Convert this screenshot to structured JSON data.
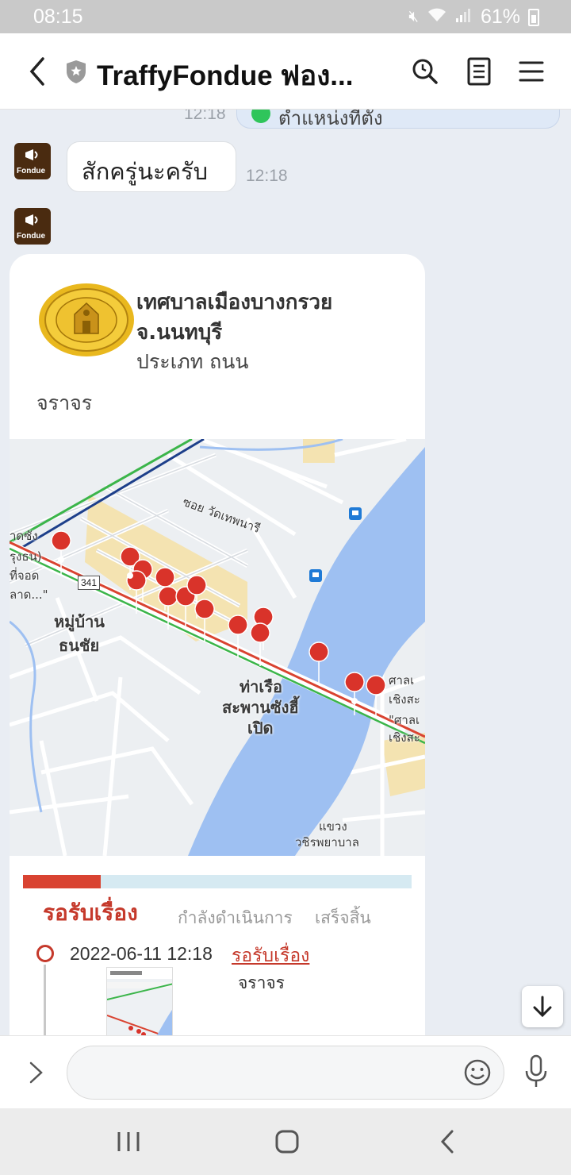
{
  "status_bar": {
    "time": "08:15",
    "battery": "61%"
  },
  "header": {
    "title": "TraffyFondue ฟอง..."
  },
  "chat": {
    "previous_message": {
      "text": "ตำแหน่งที่ตั้ง",
      "time": "12:18"
    },
    "bot_avatar_text": "Fondue",
    "message_1": {
      "text": "สักครู่นะครับ",
      "time": "12:18"
    },
    "card": {
      "org_line1": "เทศบาลเมืองบางกรวย",
      "org_line2": "จ.นนทบุรี",
      "category": "ประเภท ถนน",
      "subcategory": "จราจร",
      "map_labels": {
        "soi": "ซอย วัดเทพนารี",
        "village_1": "หมู่บ้าน",
        "village_2": "ธนชัย",
        "pier_1": "ท่าเรือ",
        "pier_2": "สะพานซังฮี้",
        "pier_3": "เปิด",
        "district_1": "แขวง",
        "district_2": "วชิรพยาบาล",
        "left_1": "าดซัง",
        "left_2": "รุงธน)",
        "left_3": "ที่จอด",
        "left_4": "ลาด...\"",
        "right_1": "ศาลเ",
        "right_2": "เชิงสะ",
        "right_3": "\"ศาลเ",
        "right_4": "เชิงสะ",
        "road_number": "341"
      },
      "progress_fraction": 0.2,
      "status_tabs": {
        "active": "รอรับเรื่อง",
        "in_progress": "กำลังดำเนินการ",
        "done": "เสร็จสิ้น"
      },
      "timeline": [
        {
          "date": "2022-06-11 12:18",
          "status": "รอรับเรื่อง",
          "subcategory": "จราจร"
        }
      ]
    }
  },
  "input": {
    "placeholder": ""
  },
  "colors": {
    "accent_red": "#c5392b",
    "progress_track": "#d6eaf2",
    "chat_bg": "#e9edf3",
    "river": "#9ec0f2"
  }
}
